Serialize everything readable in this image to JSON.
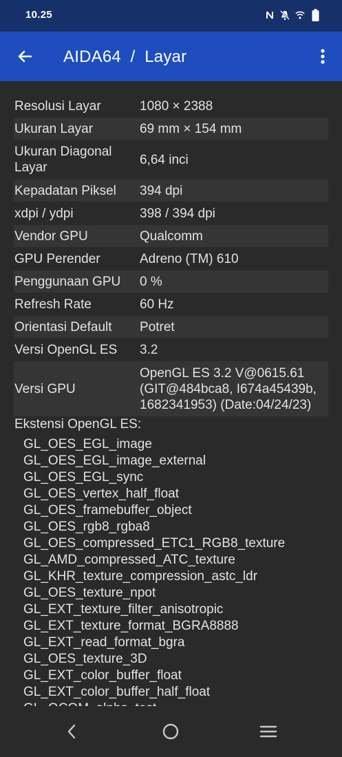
{
  "status_bar": {
    "time": "10.25",
    "icons": [
      "nfc-icon",
      "mute-icon",
      "wifi-icon",
      "battery-icon"
    ]
  },
  "app_bar": {
    "title": "AIDA64  /  Layar",
    "back_icon": "back-arrow-icon",
    "menu_icon": "more-vert-icon"
  },
  "info_rows": [
    {
      "label": "Resolusi Layar",
      "value": "1080 × 2388"
    },
    {
      "label": "Ukuran Layar",
      "value": "69 mm × 154 mm"
    },
    {
      "label": "Ukuran Diagonal Layar",
      "value": "6,64 inci"
    },
    {
      "label": "Kepadatan Piksel",
      "value": "394 dpi"
    },
    {
      "label": "xdpi / ydpi",
      "value": "398 / 394 dpi"
    },
    {
      "label": "Vendor GPU",
      "value": "Qualcomm"
    },
    {
      "label": "GPU Perender",
      "value": "Adreno (TM) 610"
    },
    {
      "label": "Penggunaan GPU",
      "value": "0 %"
    },
    {
      "label": "Refresh Rate",
      "value": "60 Hz"
    },
    {
      "label": "Orientasi Default",
      "value": "Potret"
    },
    {
      "label": "Versi OpenGL ES",
      "value": "3.2"
    },
    {
      "label": "Versi GPU",
      "value": "OpenGL ES 3.2 V@0615.61 (GIT@484bca8, I674a45439b, 1682341953) (Date:04/24/23)"
    }
  ],
  "extensions": {
    "title": "Ekstensi OpenGL ES:",
    "items": [
      "GL_OES_EGL_image",
      "GL_OES_EGL_image_external",
      "GL_OES_EGL_sync",
      "GL_OES_vertex_half_float",
      "GL_OES_framebuffer_object",
      "GL_OES_rgb8_rgba8",
      "GL_OES_compressed_ETC1_RGB8_texture",
      "GL_AMD_compressed_ATC_texture",
      "GL_KHR_texture_compression_astc_ldr",
      "GL_OES_texture_npot",
      "GL_EXT_texture_filter_anisotropic",
      "GL_EXT_texture_format_BGRA8888",
      "GL_EXT_read_format_bgra",
      "GL_OES_texture_3D",
      "GL_EXT_color_buffer_float",
      "GL_EXT_color_buffer_half_float",
      "GL_QCOM_alpha_test"
    ]
  },
  "nav_bar": {
    "icons": [
      "nav-back-icon",
      "nav-home-icon",
      "nav-recents-icon"
    ]
  },
  "colors": {
    "status_bar": "#16306a",
    "app_bar": "#1e4dbf",
    "background": "#2a2a2a",
    "row_alt": "#353535"
  }
}
